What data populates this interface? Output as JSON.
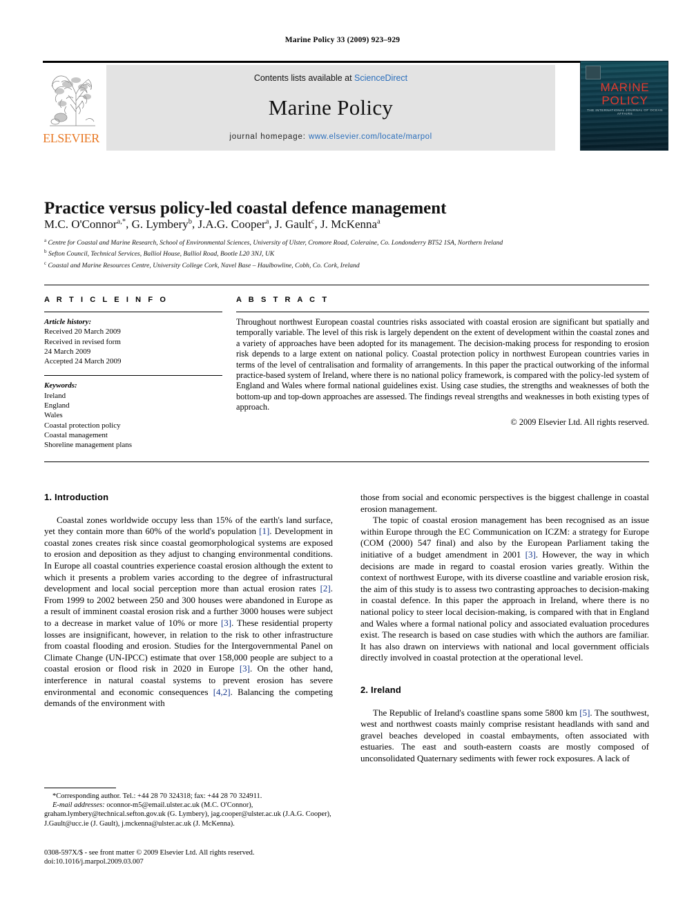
{
  "running_head": "Marine Policy 33 (2009) 923–929",
  "masthead": {
    "contents_prefix": "Contents lists available at ",
    "sciencedirect": "ScienceDirect",
    "journal_name": "Marine Policy",
    "homepage_prefix": "journal homepage: ",
    "homepage_url": "www.elsevier.com/locate/marpol",
    "publisher": "ELSEVIER",
    "publisher_color": "#E87722",
    "link_color": "#2a6ebb",
    "cover": {
      "title_line1": "MARINE",
      "title_line2": "POLICY",
      "subtitle": "THE INTERNATIONAL JOURNAL OF OCEAN AFFAIRS",
      "title_color": "#e23b2e",
      "background_color": "#0d3a4a"
    }
  },
  "article": {
    "title": "Practice versus policy-led coastal defence management",
    "authors": [
      {
        "name": "M.C. O'Connor",
        "marks": "a,*"
      },
      {
        "name": "G. Lymbery",
        "marks": "b"
      },
      {
        "name": "J.A.G. Cooper",
        "marks": "a"
      },
      {
        "name": "J. Gault",
        "marks": "c"
      },
      {
        "name": "J. McKenna",
        "marks": "a"
      }
    ],
    "affiliations": [
      {
        "mark": "a",
        "text": "Centre for Coastal and Marine Research, School of Environmental Sciences, University of Ulster, Cromore Road, Coleraine, Co. Londonderry BT52 1SA, Northern Ireland"
      },
      {
        "mark": "b",
        "text": "Sefton Council, Technical Services, Balliol House, Balliol Road, Bootle L20 3NJ, UK"
      },
      {
        "mark": "c",
        "text": "Coastal and Marine Resources Centre, University College Cork, Navel Base – Haulbowline, Cobh, Co. Cork, Ireland"
      }
    ]
  },
  "article_info": {
    "heading": "A R T I C L E    I N F O",
    "history_label": "Article history:",
    "history": [
      "Received 20 March 2009",
      "Received in revised form",
      "24 March 2009",
      "Accepted 24 March 2009"
    ],
    "keywords_label": "Keywords:",
    "keywords": [
      "Ireland",
      "England",
      "Wales",
      "Coastal protection policy",
      "Coastal management",
      "Shoreline management plans"
    ]
  },
  "abstract": {
    "heading": "A B S T R A C T",
    "text": "Throughout northwest European coastal countries risks associated with coastal erosion are significant but spatially and temporally variable. The level of this risk is largely dependent on the extent of development within the coastal zones and a variety of approaches have been adopted for its management. The decision-making process for responding to erosion risk depends to a large extent on national policy. Coastal protection policy in northwest European countries varies in terms of the level of centralisation and formality of arrangements. In this paper the practical outworking of the informal practice-based system of Ireland, where there is no national policy framework, is compared with the policy-led system of England and Wales where formal national guidelines exist. Using case studies, the strengths and weaknesses of both the bottom-up and top-down approaches are assessed. The findings reveal strengths and weaknesses in both existing types of approach.",
    "copyright": "© 2009 Elsevier Ltd. All rights reserved."
  },
  "body": {
    "left": {
      "section1_heading": "1.  Introduction",
      "p1_part1": "Coastal zones worldwide occupy less than 15% of the earth's land surface, yet they contain more than 60% of the world's population ",
      "ref1": "[1]",
      "p1_part2": ". Development in coastal zones creates risk since coastal geomorphological systems are exposed to erosion and deposition as they adjust to changing environmental conditions. In Europe all coastal countries experience coastal erosion although the extent to which it presents a problem varies according to the degree of infrastructural development and local social perception more than actual erosion rates ",
      "ref2": "[2]",
      "p1_part3": ". From 1999 to 2002 between 250 and 300 houses were abandoned in Europe as a result of imminent coastal erosion risk and a further 3000 houses were subject to a decrease in market value of 10% or more ",
      "ref3": "[3]",
      "p1_part4": ". These residential property losses are insignificant, however, in relation to the risk to other infrastructure from coastal flooding and erosion. Studies for the Intergovernmental Panel on Climate Change (UN-IPCC) estimate that over 158,000 people are subject to a coastal erosion or flood risk in 2020 in Europe ",
      "ref4": "[3]",
      "p1_part5": ". On the other hand, interference in natural coastal systems to prevent erosion has severe environmental and economic consequences ",
      "ref5": "[4,2]",
      "p1_part6": ". Balancing the competing demands of the environment with"
    },
    "right": {
      "p2_cont": "those from social and economic perspectives is the biggest challenge in coastal erosion management.",
      "p3_part1": "The topic of coastal erosion management has been recognised as an issue within Europe through the EC Communication on ICZM: a strategy for Europe (COM (2000) 547 final) and also by the European Parliament taking the initiative of a budget amendment in 2001 ",
      "ref6": "[3]",
      "p3_part2": ". However, the way in which decisions are made in regard to coastal erosion varies greatly. Within the context of northwest Europe, with its diverse coastline and variable erosion risk, the aim of this study is to assess two contrasting approaches to decision-making in coastal defence. In this paper the approach in Ireland, where there is no national policy to steer local decision-making, is compared with that in England and Wales where a formal national policy and associated evaluation procedures exist. The research is based on case studies with which the authors are familiar. It has also drawn on interviews with national and local government officials directly involved in coastal protection at the operational level.",
      "section2_heading": "2.  Ireland",
      "p4_part1": "The Republic of Ireland's coastline spans some 5800 km ",
      "ref7": "[5]",
      "p4_part2": ". The southwest, west and northwest coasts mainly comprise resistant headlands with sand and gravel beaches developed in coastal embayments, often associated with estuaries. The east and south-eastern coasts are mostly composed of unconsolidated Quaternary sediments with fewer rock exposures. A lack of"
    }
  },
  "footnotes": {
    "corresponding": "*Corresponding author. Tel.: +44 28 70 324318; fax: +44 28 70 324911.",
    "email_label": "E-mail addresses:",
    "emails": " oconnor-m5@email.ulster.ac.uk (M.C. O'Connor), graham.lymbery@technical.sefton.gov.uk (G. Lymbery), jag.cooper@ulster.ac.uk (J.A.G. Cooper), J.Gault@ucc.ie (J. Gault), j.mckenna@ulster.ac.uk (J. McKenna).",
    "issn_line": "0308-597X/$ - see front matter © 2009 Elsevier Ltd. All rights reserved.",
    "doi_line": "doi:10.1016/j.marpol.2009.03.007"
  }
}
